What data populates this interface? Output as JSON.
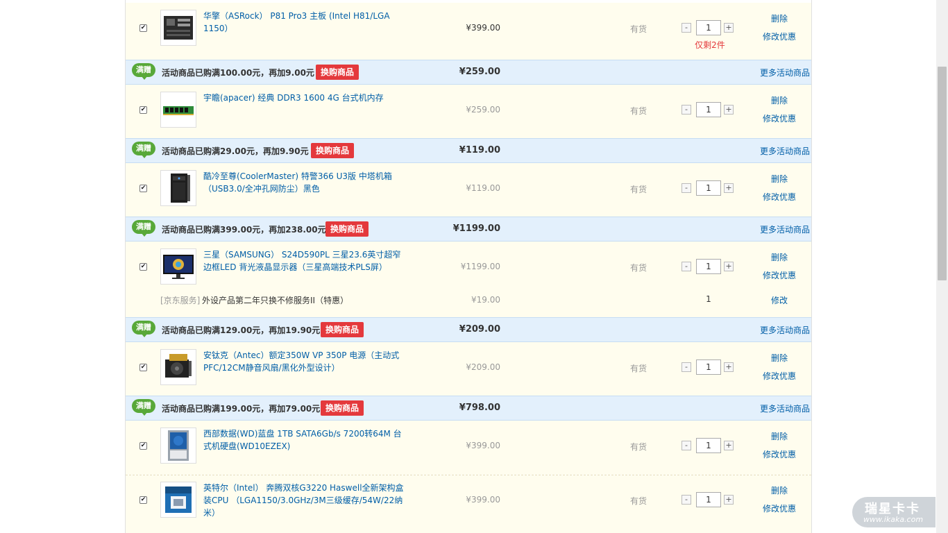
{
  "common": {
    "stock": "有货",
    "delete": "删除",
    "modify_promo": "修改优惠",
    "more_promo": "更多活动商品",
    "swap": "换购商品",
    "gift_badge": "满赠",
    "minus": "-",
    "plus": "+",
    "checkmark": "✔"
  },
  "items": [
    {
      "name": "华擎（ASRock） P81 Pro3 主板 (Intel H81/LGA 1150）",
      "price": "¥399.00",
      "qty": "1",
      "remain": "仅剩2件",
      "icon": "motherboard-image"
    },
    {
      "name": "宇瞻(apacer) 经典 DDR3 1600 4G 台式机内存",
      "price": "¥259.00",
      "qty": "1",
      "icon": "memory-image"
    },
    {
      "name": "酷冷至尊(CoolerMaster) 特警366 U3版 中塔机箱（USB3.0/全冲孔网防尘）黑色",
      "price": "¥119.00",
      "qty": "1",
      "icon": "pc-case-image"
    },
    {
      "name": "三星（SAMSUNG） S24D590PL 三星23.6英寸超窄边框LED 背光液晶显示器（三星高端技术PLS屏）",
      "price": "¥1199.00",
      "qty": "1",
      "icon": "monitor-image"
    },
    {
      "name": "安钛克（Antec）额定350W VP 350P 电源（主动式PFC/12CM静音风扇/黑化外型设计）",
      "price": "¥209.00",
      "qty": "1",
      "icon": "power-supply-image"
    },
    {
      "name": "西部数据(WD)蓝盘 1TB SATA6Gb/s 7200转64M 台式机硬盘(WD10EZEX)",
      "price": "¥399.00",
      "qty": "1",
      "icon": "hard-disk-image"
    },
    {
      "name": "英特尔（Intel） 奔腾双核G3220 Haswell全新架构盒装CPU （LGA1150/3.0GHz/3M三级缓存/54W/22纳米）",
      "price": "¥399.00",
      "qty": "1",
      "icon": "cpu-box-image"
    }
  ],
  "promos": [
    {
      "spent": "活动商品已购满100.00元，再加9.00元",
      "total": "¥259.00"
    },
    {
      "spent": "活动商品已购满29.00元，再加9.90元",
      "total": "¥119.00"
    },
    {
      "spent": "活动商品已购满399.00元，再加238.00元",
      "total": "¥1199.00"
    },
    {
      "spent": "活动商品已购满129.00元，再加19.90元",
      "total": "¥209.00"
    },
    {
      "spent": "活动商品已购满199.00元，再加79.00元",
      "total": "¥798.00"
    }
  ],
  "service": {
    "label": "[京东服务]",
    "name": "外设产品第二年只换不修服务II（特惠）",
    "price": "¥19.00",
    "qty": "1",
    "op": "修改"
  },
  "watermark": {
    "brand": "瑞星卡卡",
    "url": "www.ikaka.com"
  }
}
